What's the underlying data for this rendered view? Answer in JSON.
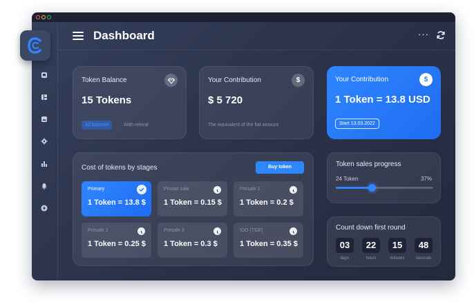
{
  "header": {
    "title": "Dashboard",
    "more_label": "···"
  },
  "token_balance": {
    "title": "Token Balance",
    "value": "15 Tokens",
    "tag": "All balance",
    "note": "With referal"
  },
  "contribution": {
    "title": "Your Contribution",
    "value": "$ 5 720",
    "note": "The equivalent of the fiat amount",
    "icon_label": "$"
  },
  "contribution_blue": {
    "title": "Your Contribution",
    "value": "1 Token = 13.8 USD",
    "start": "Start 13.03.2022",
    "icon_label": "$"
  },
  "stages": {
    "title": "Cost of tokens by stages",
    "buy_label": "Buy token",
    "items": [
      {
        "name": "Primary",
        "price": "1 Token = 13.8 $"
      },
      {
        "name": "Private sale",
        "price": "1 Token = 0.15 $"
      },
      {
        "name": "Presale 1",
        "price": "1 Token = 0.2 $"
      },
      {
        "name": "Presale 2",
        "price": "1 Token = 0.25 $"
      },
      {
        "name": "Presale 3",
        "price": "1 Token = 0.3 $"
      },
      {
        "name": "IDO (TGE)",
        "price": "1 Token = 0.35 $"
      }
    ]
  },
  "progress": {
    "title": "Token sales progress",
    "label": "24 Token",
    "percent_label": "37%",
    "value": 0.37
  },
  "countdown": {
    "title": "Count down first round",
    "units": [
      {
        "value": "03",
        "label": "days"
      },
      {
        "value": "22",
        "label": "hours"
      },
      {
        "value": "15",
        "label": "minutes"
      },
      {
        "value": "48",
        "label": "seconds"
      }
    ]
  },
  "colors": {
    "accent": "#2f86ff",
    "panel": "#2a3149"
  }
}
